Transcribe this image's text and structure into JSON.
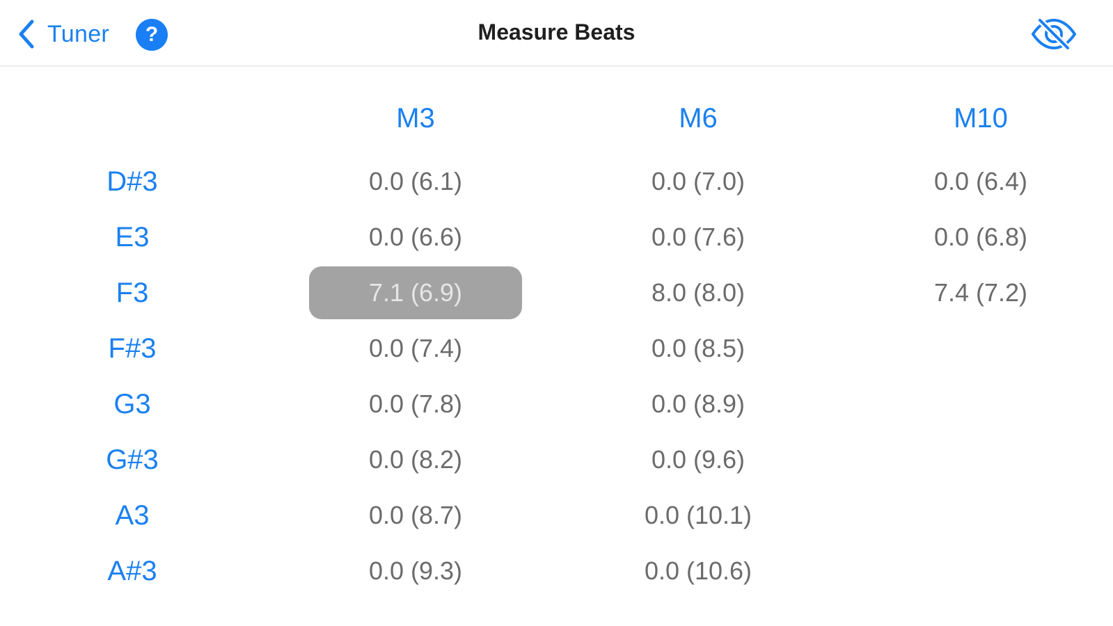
{
  "nav": {
    "back_label": "Tuner",
    "help_symbol": "?",
    "title": "Measure Beats",
    "icons": {
      "back": "chevron-left-icon",
      "help": "question-mark-circle-icon",
      "visibility": "eye-slash-icon"
    },
    "accent_color": "#1a80f0"
  },
  "table": {
    "columns": [
      "M3",
      "M6",
      "M10"
    ],
    "rows": [
      {
        "note": "D#3",
        "cells": [
          "0.0 (6.1)",
          "0.0 (7.0)",
          "0.0 (6.4)"
        ]
      },
      {
        "note": "E3",
        "cells": [
          "0.0 (6.6)",
          "0.0 (7.6)",
          "0.0 (6.8)"
        ]
      },
      {
        "note": "F3",
        "cells": [
          "7.1 (6.9)",
          "8.0 (8.0)",
          "7.4 (7.2)"
        ]
      },
      {
        "note": "F#3",
        "cells": [
          "0.0 (7.4)",
          "0.0 (8.5)",
          ""
        ]
      },
      {
        "note": "G3",
        "cells": [
          "0.0 (7.8)",
          "0.0 (8.9)",
          ""
        ]
      },
      {
        "note": "G#3",
        "cells": [
          "0.0 (8.2)",
          "0.0 (9.6)",
          ""
        ]
      },
      {
        "note": "A3",
        "cells": [
          "0.0 (8.7)",
          "0.0 (10.1)",
          ""
        ]
      },
      {
        "note": "A#3",
        "cells": [
          "0.0 (9.3)",
          "0.0 (10.6)",
          ""
        ]
      }
    ],
    "selected": {
      "row": "F3",
      "column": "M3"
    }
  }
}
